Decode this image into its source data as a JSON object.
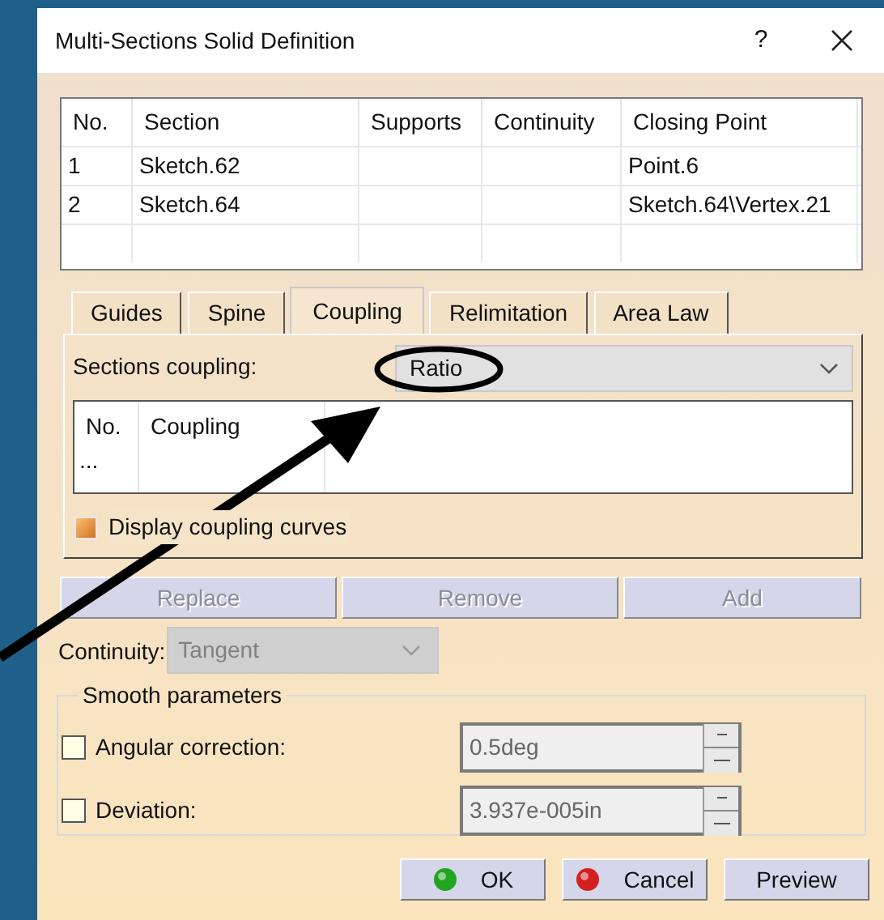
{
  "window": {
    "title": "Multi-Sections Solid Definition",
    "help": "?"
  },
  "sections_table": {
    "columns": [
      "No.",
      "Section",
      "Supports",
      "Continuity",
      "Closing Point"
    ],
    "rows": [
      [
        "1",
        "Sketch.62",
        "",
        "",
        "Point.6"
      ],
      [
        "2",
        "Sketch.64",
        "",
        "",
        "Sketch.64\\Vertex.21"
      ]
    ]
  },
  "tabs": [
    {
      "label": "Guides",
      "selected": false
    },
    {
      "label": "Spine",
      "selected": false
    },
    {
      "label": "Coupling",
      "selected": true
    },
    {
      "label": "Relimitation",
      "selected": false
    },
    {
      "label": "Area Law",
      "selected": false
    }
  ],
  "coupling": {
    "label": "Sections coupling:",
    "value": "Ratio",
    "columns": [
      "No.",
      "Coupling"
    ],
    "rows": [
      [
        "..."
      ]
    ],
    "display_curves": {
      "label": "Display coupling curves",
      "checked": true
    }
  },
  "list_buttons": [
    {
      "label": "Replace",
      "disabled": true
    },
    {
      "label": "Remove",
      "disabled": true
    },
    {
      "label": "Add",
      "disabled": true
    }
  ],
  "continuity": {
    "label": "Continuity:",
    "value": "Tangent",
    "disabled": true
  },
  "smooth_parameters": {
    "title": "Smooth parameters",
    "items": [
      {
        "label": "Angular correction:",
        "checked": false,
        "value": "0.5deg"
      },
      {
        "label": "Deviation:",
        "checked": false,
        "value": "3.937e-005in"
      }
    ]
  },
  "buttons": [
    {
      "label": "OK",
      "kind": "ok"
    },
    {
      "label": "Cancel",
      "kind": "cancel"
    },
    {
      "label": "Preview",
      "kind": "plain"
    }
  ]
}
